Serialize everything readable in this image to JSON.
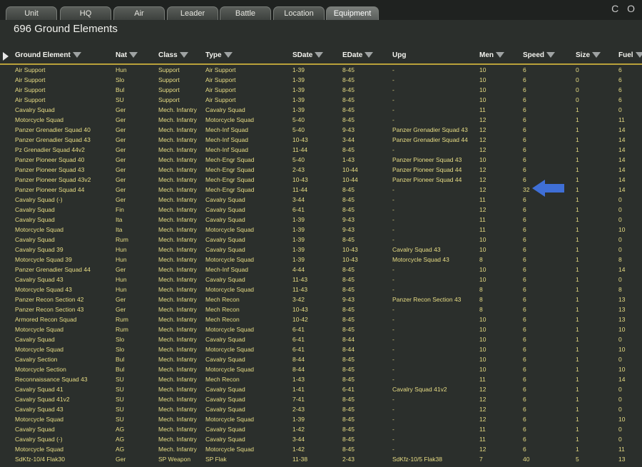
{
  "tabs": [
    {
      "label": "Unit",
      "active": false
    },
    {
      "label": "HQ",
      "active": false
    },
    {
      "label": "Air",
      "active": false
    },
    {
      "label": "Leader",
      "active": false
    },
    {
      "label": "Battle",
      "active": false
    },
    {
      "label": "Location",
      "active": false
    },
    {
      "label": "Equipment",
      "active": true
    }
  ],
  "corner_text": "C O",
  "panel_title": "696 Ground Elements",
  "columns": [
    "Ground Element",
    "Nat",
    "Class",
    "Type",
    "SDate",
    "EDate",
    "Upg",
    "Men",
    "Speed",
    "Size",
    "Fuel"
  ],
  "rows": [
    [
      "Air Support",
      "Hun",
      "Support",
      "Air Support",
      "1-39",
      "8-45",
      "-",
      "10",
      "6",
      "0",
      "6"
    ],
    [
      "Air Support",
      "Slo",
      "Support",
      "Air Support",
      "1-39",
      "8-45",
      "-",
      "10",
      "6",
      "0",
      "6"
    ],
    [
      "Air Support",
      "Bul",
      "Support",
      "Air Support",
      "1-39",
      "8-45",
      "-",
      "10",
      "6",
      "0",
      "6"
    ],
    [
      "Air Support",
      "SU",
      "Support",
      "Air Support",
      "1-39",
      "8-45",
      "-",
      "10",
      "6",
      "0",
      "6"
    ],
    [
      "Cavalry Squad",
      "Ger",
      "Mech. Infantry",
      "Cavalry Squad",
      "1-39",
      "8-45",
      "-",
      "11",
      "6",
      "1",
      "0"
    ],
    [
      "Motorcycle Squad",
      "Ger",
      "Mech. Infantry",
      "Motorcycle Squad",
      "5-40",
      "8-45",
      "-",
      "12",
      "6",
      "1",
      "11"
    ],
    [
      "Panzer Grenadier Squad 40",
      "Ger",
      "Mech. Infantry",
      "Mech-Inf Squad",
      "5-40",
      "9-43",
      "Panzer Grenadier Squad 43",
      "12",
      "6",
      "1",
      "14"
    ],
    [
      "Panzer Grenadier Squad 43",
      "Ger",
      "Mech. Infantry",
      "Mech-Inf Squad",
      "10-43",
      "3-44",
      "Panzer Grenadier Squad 44",
      "12",
      "6",
      "1",
      "14"
    ],
    [
      "Pz Grenadier Squad 44v2",
      "Ger",
      "Mech. Infantry",
      "Mech-Inf Squad",
      "11-44",
      "8-45",
      "-",
      "12",
      "6",
      "1",
      "14"
    ],
    [
      "Panzer Pioneer Squad 40",
      "Ger",
      "Mech. Infantry",
      "Mech-Engr Squad",
      "5-40",
      "1-43",
      "Panzer Pioneer Squad 43",
      "10",
      "6",
      "1",
      "14"
    ],
    [
      "Panzer Pioneer Squad 43",
      "Ger",
      "Mech. Infantry",
      "Mech-Engr Squad",
      "2-43",
      "10-44",
      "Panzer Pioneer Squad 44",
      "12",
      "6",
      "1",
      "14"
    ],
    [
      "Panzer Pioneer Squad 43v2",
      "Ger",
      "Mech. Infantry",
      "Mech-Engr Squad",
      "10-43",
      "10-44",
      "Panzer Pioneer Squad 44",
      "12",
      "6",
      "1",
      "14"
    ],
    [
      "Panzer Pioneer Squad 44",
      "Ger",
      "Mech. Infantry",
      "Mech-Engr Squad",
      "11-44",
      "8-45",
      "-",
      "12",
      "32",
      "1",
      "14"
    ],
    [
      "Cavalry Squad (-)",
      "Ger",
      "Mech. Infantry",
      "Cavalry Squad",
      "3-44",
      "8-45",
      "-",
      "11",
      "6",
      "1",
      "0"
    ],
    [
      "Cavalry Squad",
      "Fin",
      "Mech. Infantry",
      "Cavalry Squad",
      "6-41",
      "8-45",
      "-",
      "12",
      "6",
      "1",
      "0"
    ],
    [
      "Cavalry Squad",
      "Ita",
      "Mech. Infantry",
      "Cavalry Squad",
      "1-39",
      "9-43",
      "-",
      "11",
      "6",
      "1",
      "0"
    ],
    [
      "Motorcycle Squad",
      "Ita",
      "Mech. Infantry",
      "Motorcycle Squad",
      "1-39",
      "9-43",
      "-",
      "11",
      "6",
      "1",
      "10"
    ],
    [
      "Cavalry Squad",
      "Rum",
      "Mech. Infantry",
      "Cavalry Squad",
      "1-39",
      "8-45",
      "-",
      "10",
      "6",
      "1",
      "0"
    ],
    [
      "Cavalry Squad 39",
      "Hun",
      "Mech. Infantry",
      "Cavalry Squad",
      "1-39",
      "10-43",
      "Cavalry Squad 43",
      "10",
      "6",
      "1",
      "0"
    ],
    [
      "Motorcycle Squad 39",
      "Hun",
      "Mech. Infantry",
      "Motorcycle Squad",
      "1-39",
      "10-43",
      "Motorcycle Squad 43",
      "8",
      "6",
      "1",
      "8"
    ],
    [
      "Panzer Grenadier Squad 44",
      "Ger",
      "Mech. Infantry",
      "Mech-Inf Squad",
      "4-44",
      "8-45",
      "-",
      "10",
      "6",
      "1",
      "14"
    ],
    [
      "Cavalry Squad 43",
      "Hun",
      "Mech. Infantry",
      "Cavalry Squad",
      "11-43",
      "8-45",
      "-",
      "10",
      "6",
      "1",
      "0"
    ],
    [
      "Motorcycle Squad 43",
      "Hun",
      "Mech. Infantry",
      "Motorcycle Squad",
      "11-43",
      "8-45",
      "-",
      "8",
      "6",
      "1",
      "8"
    ],
    [
      "Panzer Recon Section 42",
      "Ger",
      "Mech. Infantry",
      "Mech Recon",
      "3-42",
      "9-43",
      "Panzer Recon Section 43",
      "8",
      "6",
      "1",
      "13"
    ],
    [
      "Panzer Recon Section 43",
      "Ger",
      "Mech. Infantry",
      "Mech Recon",
      "10-43",
      "8-45",
      "-",
      "8",
      "6",
      "1",
      "13"
    ],
    [
      "Armored Recon Squad",
      "Rum",
      "Mech. Infantry",
      "Mech Recon",
      "10-42",
      "8-45",
      "-",
      "10",
      "6",
      "1",
      "13"
    ],
    [
      "Motorcycle Squad",
      "Rum",
      "Mech. Infantry",
      "Motorcycle Squad",
      "6-41",
      "8-45",
      "-",
      "10",
      "6",
      "1",
      "10"
    ],
    [
      "Cavalry Squad",
      "Slo",
      "Mech. Infantry",
      "Cavalry Squad",
      "6-41",
      "8-44",
      "-",
      "10",
      "6",
      "1",
      "0"
    ],
    [
      "Motorcycle Squad",
      "Slo",
      "Mech. Infantry",
      "Motorcycle Squad",
      "6-41",
      "8-44",
      "-",
      "10",
      "6",
      "1",
      "10"
    ],
    [
      "Cavalry Section",
      "Bul",
      "Mech. Infantry",
      "Cavalry Squad",
      "8-44",
      "8-45",
      "-",
      "10",
      "6",
      "1",
      "0"
    ],
    [
      "Motorcycle Section",
      "Bul",
      "Mech. Infantry",
      "Motorcycle Squad",
      "8-44",
      "8-45",
      "-",
      "10",
      "6",
      "1",
      "10"
    ],
    [
      "Reconnaissance Squad 43",
      "SU",
      "Mech. Infantry",
      "Mech Recon",
      "1-43",
      "8-45",
      "-",
      "11",
      "6",
      "1",
      "14"
    ],
    [
      "Cavalry Squad 41",
      "SU",
      "Mech. Infantry",
      "Cavalry Squad",
      "1-41",
      "6-41",
      "Cavalry Squad 41v2",
      "12",
      "6",
      "1",
      "0"
    ],
    [
      "Cavalry Squad 41v2",
      "SU",
      "Mech. Infantry",
      "Cavalry Squad",
      "7-41",
      "8-45",
      "-",
      "12",
      "6",
      "1",
      "0"
    ],
    [
      "Cavalry Squad 43",
      "SU",
      "Mech. Infantry",
      "Cavalry Squad",
      "2-43",
      "8-45",
      "-",
      "12",
      "6",
      "1",
      "0"
    ],
    [
      "Motorcycle Squad",
      "SU",
      "Mech. Infantry",
      "Motorcycle Squad",
      "1-39",
      "8-45",
      "-",
      "12",
      "6",
      "1",
      "10"
    ],
    [
      "Cavalry Squad",
      "AG",
      "Mech. Infantry",
      "Cavalry Squad",
      "1-42",
      "8-45",
      "-",
      "11",
      "6",
      "1",
      "0"
    ],
    [
      "Cavalry Squad (-)",
      "AG",
      "Mech. Infantry",
      "Cavalry Squad",
      "3-44",
      "8-45",
      "-",
      "11",
      "6",
      "1",
      "0"
    ],
    [
      "Motorcycle Squad",
      "AG",
      "Mech. Infantry",
      "Motorcycle Squad",
      "1-42",
      "8-45",
      "-",
      "12",
      "6",
      "1",
      "11"
    ],
    [
      "SdKfz-10/4 Flak30",
      "Ger",
      "SP Weapon",
      "SP Flak",
      "11-38",
      "2-43",
      "SdKfz-10/5 Flak38",
      "7",
      "40",
      "5",
      "13"
    ]
  ],
  "colors": {
    "row_text": "#e8dd84",
    "header_line": "#b9a13a",
    "pointer": "#3f6fd6"
  },
  "pointer_icon": "blue-arrow-icon"
}
